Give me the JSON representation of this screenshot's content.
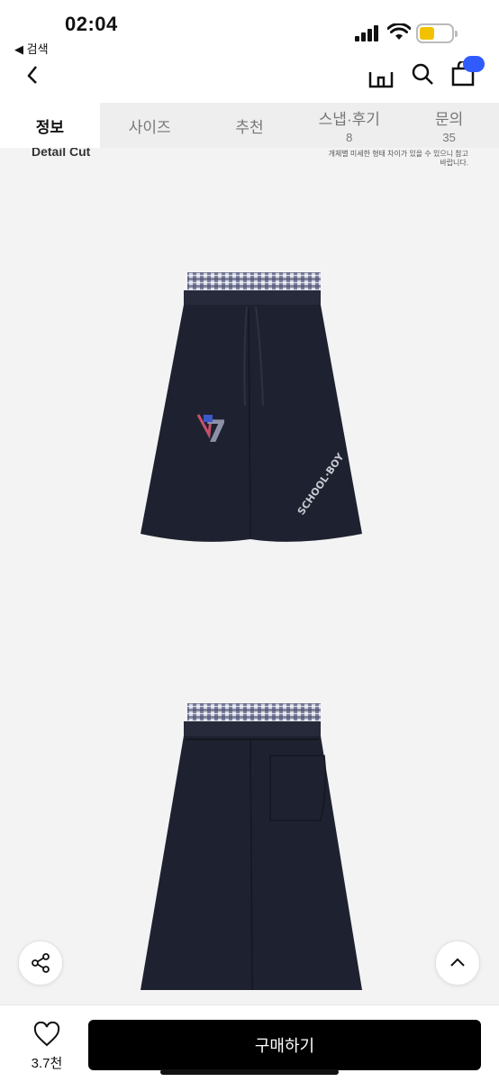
{
  "status_bar": {
    "time": "02:04",
    "back_app_label": "◀ 검색"
  },
  "nav": {
    "back_icon": "chevron-left-icon",
    "home_icon": "home-icon",
    "search_icon": "search-icon",
    "cart_icon": "cart-icon"
  },
  "tabs": [
    {
      "label": "정보",
      "count": ""
    },
    {
      "label": "사이즈",
      "count": ""
    },
    {
      "label": "추천",
      "count": ""
    },
    {
      "label": "스냅·후기",
      "count": "8"
    },
    {
      "label": "문의",
      "count": "35"
    }
  ],
  "content": {
    "section_title": "Detail Cut",
    "notice": "개체별 미세한 형태 차이가 있을 수 있으니 참고 바랍니다.",
    "front_logo_text": "SCHOOL·BOY",
    "front_number": "7"
  },
  "bottom_bar": {
    "like_count": "3.7천",
    "buy_label": "구매하기"
  },
  "colors": {
    "accent": "#2f5bff",
    "buy_button": "#000000",
    "shorts": "#1e2230"
  }
}
